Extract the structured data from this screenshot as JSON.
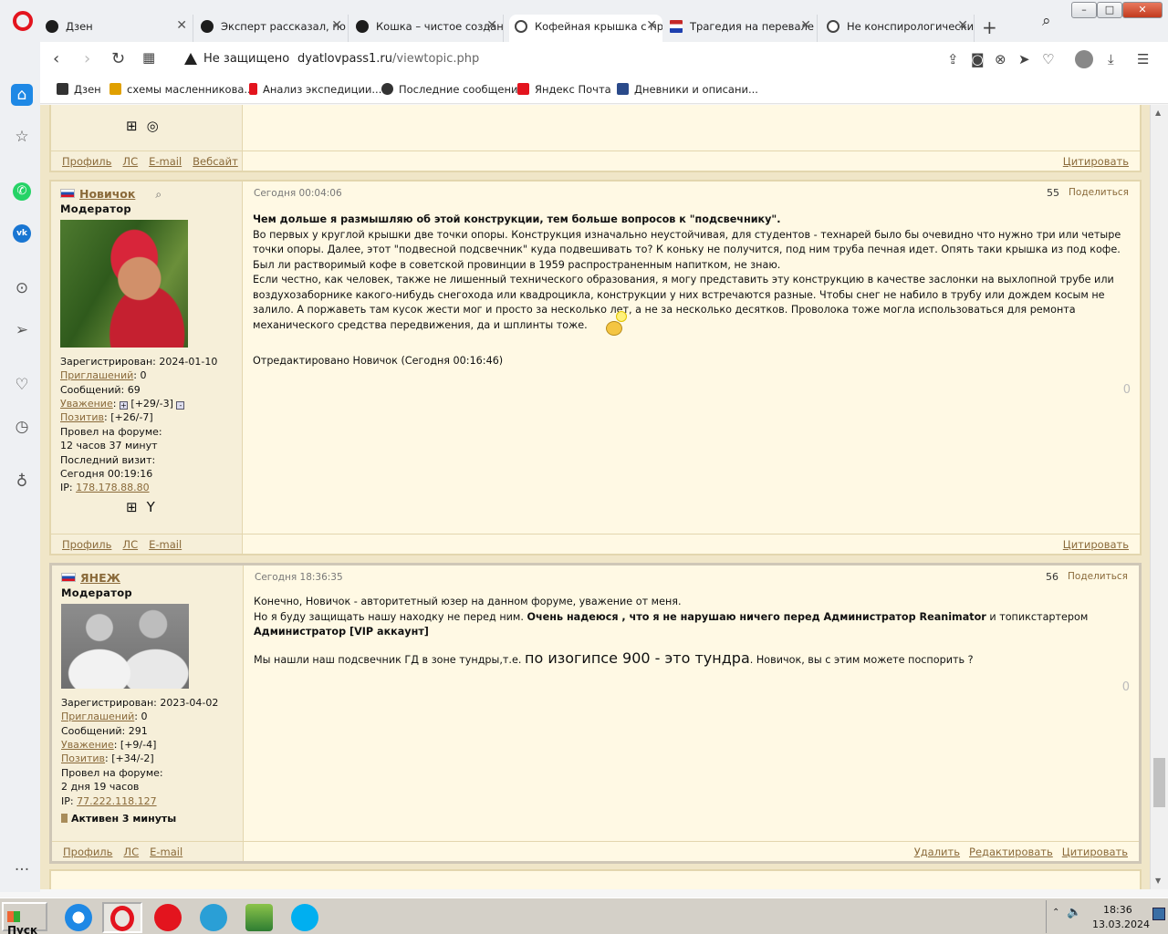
{
  "browser": {
    "tabs": [
      {
        "label": "Дзен",
        "favicon": "dzen-icon",
        "active": false
      },
      {
        "label": "Эксперт рассказал, по",
        "favicon": "dzen-icon",
        "active": false
      },
      {
        "label": "Кошка – чистое создан",
        "favicon": "dzen-icon",
        "active": false
      },
      {
        "label": "Кофейная крышка с пр",
        "favicon": "globe-icon",
        "active": true
      },
      {
        "label": "Трагедия на перевале",
        "favicon": "flag-icon",
        "active": false
      },
      {
        "label": "Не конспирологически",
        "favicon": "globe-icon",
        "active": false
      }
    ],
    "address": {
      "security_label": "Не защищено",
      "url_host": "dyatlovpass1.ru",
      "url_path": "/viewtopic.php"
    },
    "bookmarks": [
      {
        "label": "Дзен",
        "color": "#333333"
      },
      {
        "label": "схемы масленникова...",
        "color": "#e0a000"
      },
      {
        "label": "Анализ экспедиции....",
        "color": "#e3141e"
      },
      {
        "label": "Последние сообщения",
        "color": "#333333"
      },
      {
        "label": "Яндекс Почта",
        "color": "#e3141e"
      },
      {
        "label": "Дневники и описани...",
        "color": "#2a4a8a"
      }
    ]
  },
  "posts": [
    {
      "footer_left": [
        "Профиль",
        "ЛС",
        "E-mail",
        "Вебсайт"
      ],
      "footer_right": [
        "Цитировать"
      ]
    },
    {
      "author": "Новичок",
      "role": "Модератор",
      "registered": "Зарегистрирован: 2024-01-10",
      "invites_label": "Приглашений",
      "invites_value": ": 0",
      "messages": "Сообщений: 69",
      "respect_label": "Уважение",
      "respect_value": "[+29/-3]",
      "positive_label": "Позитив",
      "positive_value": ": [+26/-7]",
      "time_on_forum_label": "Провел на форуме:",
      "time_on_forum_value": "12 часов 37 минут",
      "last_visit_label": "Последний визит:",
      "last_visit_value": "Сегодня 00:19:16",
      "ip_label": "IP: ",
      "ip": "178.178.88.80",
      "date": "Сегодня 00:04:06",
      "number": "55",
      "share": "Поделиться",
      "title_bold": "Чем дольше я размышляю об этой конструкции, тем больше вопросов к \"подсвечнику\".",
      "body_1": "Во первых у круглой крышки две точки опоры. Конструкция изначально неустойчивая, для студентов - технарей было бы очевидно что нужно три или четыре точки опоры. Далее, этот \"подвесной подсвечник\" куда подвешивать то? К коньку не получится, под ним труба печная идет. Опять таки крышка из под кофе. Был ли растворимый кофе в советской провинции в 1959 распространенным напитком, не знаю.",
      "body_2": "Если честно, как человек, также не лишенный технического образования, я могу представить эту конструкцию в качестве заслонки на выхлопной трубе или воздухозаборнике какого-нибудь снегохода или квадроцикла, конструкции у них встречаются разные. Чтобы снег не набило в трубу или дождем косым не залило. А поржаветь там кусок жести мог и просто за несколько лет, а не за несколько десятков. Проволока тоже могла использоваться для ремонта механического средства передвижения, да и шплинты тоже.",
      "edited": "Отредактировано Новичок (Сегодня 00:16:46)",
      "likes": "0",
      "footer_left": [
        "Профиль",
        "ЛС",
        "E-mail"
      ],
      "footer_right": [
        "Цитировать"
      ]
    },
    {
      "author": "ЯНЕЖ",
      "role": "Модератор",
      "registered": "Зарегистрирован: 2023-04-02",
      "invites_label": "Приглашений",
      "invites_value": ": 0",
      "messages": "Сообщений: 291",
      "respect_label": "Уважение",
      "respect_value": ": [+9/-4]",
      "positive_label": "Позитив",
      "positive_value": ": [+34/-2]",
      "time_on_forum_label": "Провел на форуме:",
      "time_on_forum_value": "2 дня 19 часов",
      "ip_label": "IP: ",
      "ip": "77.222.118.127",
      "active": "Активен 3 минуты",
      "date": "Сегодня 18:36:35",
      "number": "56",
      "share": "Поделиться",
      "line_1": "Конечно,  Новичок - авторитетный юзер на данном форуме, уважение от меня.",
      "line_2_start": "Но я буду защищать нашу находку не перед ним. ",
      "line_2_bold": "Очень надеюся , что я не нарушаю ничего  перед Администратор Reanimator",
      "line_2_mid": " и топикстартером ",
      "line_2_bold2": "Администратор [VIP аккаунт]",
      "line_3_start": "Мы нашли наш подсвечник ГД в зоне тундры,т.е. ",
      "line_3_big": "по изогипсе 900 - это тундра",
      "line_3_end": ". Новичок, вы с этим можете поспорить ?",
      "likes": "0",
      "footer_left": [
        "Профиль",
        "ЛС",
        "E-mail"
      ],
      "footer_right": [
        "Удалить",
        "Редактировать",
        "Цитировать"
      ]
    }
  ],
  "taskbar": {
    "start_label": "Пуск",
    "time": "18:36",
    "date": "13.03.2024"
  },
  "colors": {
    "page_bg": "#f0e6c8",
    "post_bg": "#fff9e4",
    "link": "#8a6a3a",
    "opera_red": "#e3141e"
  }
}
